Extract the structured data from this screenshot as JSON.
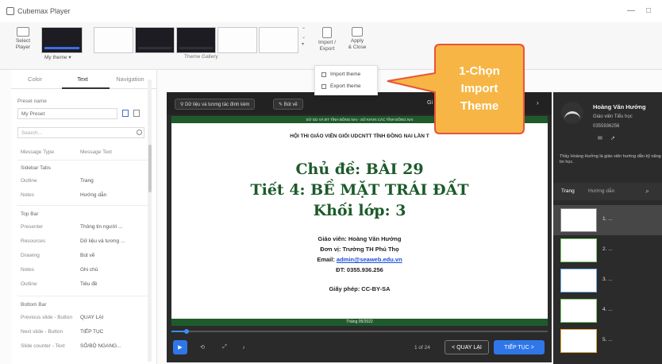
{
  "app": {
    "title": "Cubemax Player",
    "minimize": "—",
    "maximize": "□"
  },
  "ribbon": {
    "select_player": "Select\nPlayer",
    "my_theme": "My theme ▾",
    "theme_gallery": "Theme Gallery",
    "import_export": "Import /\nExport",
    "apply_close": "Apply\n& Close",
    "chevrons": [
      "⌃",
      "⌄",
      "▾"
    ]
  },
  "dropdown": {
    "import": "Import theme",
    "export": "Export theme"
  },
  "callout": {
    "line1": "1-Chọn",
    "line2": "Import",
    "line3": "Theme",
    "fill": "#f6b544",
    "stroke": "#e8543a",
    "text_color": "#ffffff"
  },
  "left": {
    "tabs": [
      "Color",
      "Text",
      "Navigation"
    ],
    "preset_label": "Preset name",
    "preset_value": "My Preset",
    "search_placeholder": "Search...",
    "col_message_type": "Message Type",
    "col_message_text": "Message Text",
    "sections": {
      "sidebar": "Sidebar Tabs",
      "topbar": "Top Bar",
      "bottombar": "Bottom Bar"
    },
    "sidebar_rows": [
      {
        "k": "Outline",
        "v": "Trang"
      },
      {
        "k": "Notes",
        "v": "Hướng dẫn"
      }
    ],
    "topbar_rows": [
      {
        "k": "Presenter",
        "v": "Thông tin người ..."
      },
      {
        "k": "Resources",
        "v": "Dữ liệu và tương ..."
      },
      {
        "k": "Drawing",
        "v": "Bút vẽ"
      },
      {
        "k": "Notes",
        "v": "Ghi chú"
      },
      {
        "k": "Outline",
        "v": "Tiêu đề"
      }
    ],
    "bottombar_rows": [
      {
        "k": "Previous slide - Button",
        "v": "QUAY LẠI"
      },
      {
        "k": "Next slide - Button",
        "v": "TIẾP TỤC"
      },
      {
        "k": "Slide counter - Text",
        "v": "SỐ/BỘ NGANG..."
      }
    ]
  },
  "player": {
    "btn_resources": "Dữ liệu và tương tác đính kèm",
    "btn_draw": "Bút vẽ",
    "top_right_letters": "Gi",
    "slide": {
      "header": "SỞ GD VÀ ĐT TỈNH ĐỒNG NAI - SỞ KHVN CÁC TỈNH ĐỒNG NAI",
      "contest": "HỘI THI GIÁO VIÊN GIỎI UDCNTT TỈNH ĐỒNG NAI LẦN T",
      "topic": "Chủ đề: BÀI 29",
      "lesson": "Tiết 4: BỀ MẶT TRÁI ĐẤT",
      "grade": "Khối lớp: 3",
      "teacher": "Giáo viên: Hoàng Văn Hưởng",
      "unit": "Đơn vị: Trường TH Phú Thọ",
      "email_label": "Email:",
      "email": "admin@seaweb.edu.vn",
      "phone": "ĐT: 0355.936.256",
      "license": "Giấy phép: CC-BY-SA",
      "date": "Tháng 05/2022"
    },
    "progress": 0.04,
    "counter": "1 of 24",
    "prev": "< QUAY LẠI",
    "next": "TIẾP TỤC >"
  },
  "right": {
    "name": "Hoàng Văn Hưởng",
    "role": "Giáo viên Tiểu học",
    "phone": "0355936256",
    "desc": "Thầy Hoàng Hưởng là giáo viên hướng dẫn kỹ năng tin học.",
    "tab_outline": "Trang",
    "tab_notes": "Hướng dẫn",
    "items": [
      "1. ...",
      "2. ...",
      "3. ...",
      "4. ...",
      "5. ..."
    ]
  }
}
